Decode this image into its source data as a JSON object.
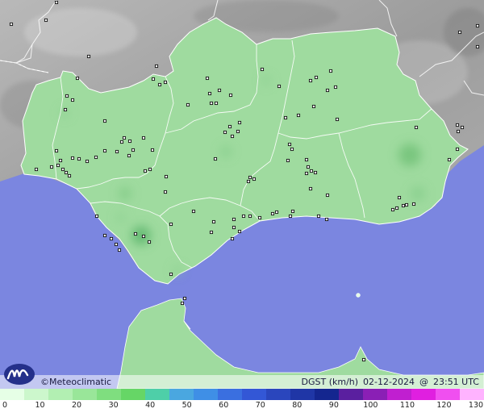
{
  "brand": {
    "label": "©Meteoclimatic"
  },
  "map_info": {
    "variable": "DGST (km/h)",
    "date": "02-12-2024",
    "at": "@",
    "time": "23:51 UTC"
  },
  "legend": {
    "ticks": [
      "0",
      "10",
      "20",
      "30",
      "40",
      "50",
      "60",
      "70",
      "80",
      "90",
      "100",
      "110",
      "120",
      "130"
    ],
    "colors": [
      "#e6ffe6",
      "#ccf7cc",
      "#b2efb2",
      "#99e699",
      "#7fde7f",
      "#66d666",
      "#4ecfa8",
      "#4aa7e0",
      "#3f8fe6",
      "#3a6fe0",
      "#3357d6",
      "#2a46bd",
      "#1f36a6",
      "#14268f",
      "#5a1f9f",
      "#8a1fb5",
      "#c01fd0",
      "#e01fe0",
      "#f04ff0",
      "#ffb3ff"
    ]
  },
  "colors": {
    "sea": "#7b86e0",
    "land_neighbour": "#a8a8a8",
    "land_region": "#9fdb9f",
    "station_marker": "#111111"
  },
  "icons": [
    "meteoclimatic-logo-icon"
  ]
}
